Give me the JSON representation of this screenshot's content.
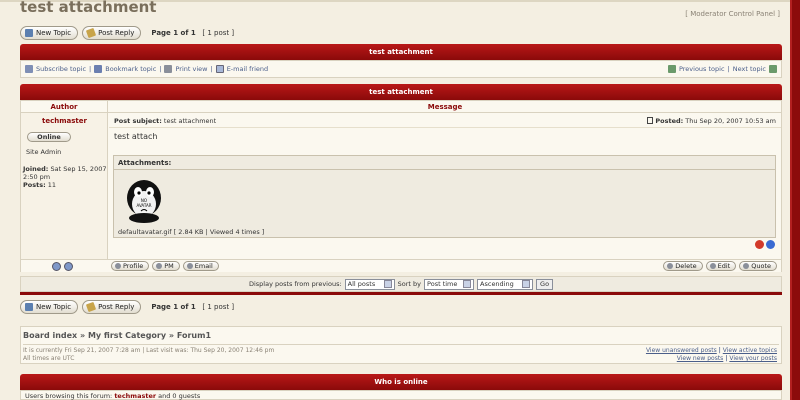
{
  "topic": {
    "title": "test attachment",
    "mcp_label": "Moderator Control Panel",
    "mcp_open": "[",
    "mcp_close": "]"
  },
  "buttons": {
    "new_topic": "New Topic",
    "post_reply": "Post Reply"
  },
  "pagination": {
    "page_label": "Page 1 of 1",
    "post_count": "[ 1 post ]"
  },
  "topic_bar_title": "test attachment",
  "actions": {
    "subscribe": "Subscribe topic",
    "bookmark": "Bookmark topic",
    "print": "Print view",
    "email": "E-mail friend",
    "prev": "Previous topic",
    "next": "Next topic",
    "sep": "|"
  },
  "post_bar_title": "test attachment",
  "post": {
    "author_header": "Author",
    "message_header": "Message",
    "author": "techmaster",
    "online": "Online",
    "rank": "Site Admin",
    "joined_label": "Joined:",
    "joined_value": "Sat Sep 15, 2007 2:50 pm",
    "posts_label": "Posts:",
    "posts_value": "11",
    "subject_label": "Post subject:",
    "subject_value": "test attachment",
    "posted_label": "Posted:",
    "posted_value": "Thu Sep 20, 2007 10:53 am",
    "body": "test attach",
    "attachments_label": "Attachments:",
    "avatar_text_1": "NO",
    "avatar_text_2": "AVATAR",
    "attachment_info": "defaultavatar.gif [ 2.84 KB | Viewed 4 times ]"
  },
  "post_buttons": {
    "profile": "Profile",
    "pm": "PM",
    "email": "Email",
    "delete": "Delete",
    "edit": "Edit",
    "quote": "Quote"
  },
  "sort": {
    "display_label": "Display posts from previous:",
    "all_posts": "All posts",
    "sort_by": "Sort by",
    "post_time": "Post time",
    "ascending": "Ascending",
    "go": "Go"
  },
  "breadcrumb": {
    "board_index": "Board index",
    "category": "My first Category",
    "forum": "Forum1",
    "separator": "»"
  },
  "board_info": {
    "current_time": "It is currently Fri Sep 21, 2007 7:28 am | Last visit was: Thu Sep 20, 2007 12:46 pm",
    "timezone": "All times are UTC",
    "unanswered": "View unanswered posts",
    "active": "View active topics",
    "new_posts": "View new posts",
    "your_posts": "View your posts",
    "sep": "|"
  },
  "who_online": {
    "title": "Who is online",
    "prefix": "Users browsing this forum:",
    "user": "techmaster",
    "suffix": "and 0 guests"
  }
}
